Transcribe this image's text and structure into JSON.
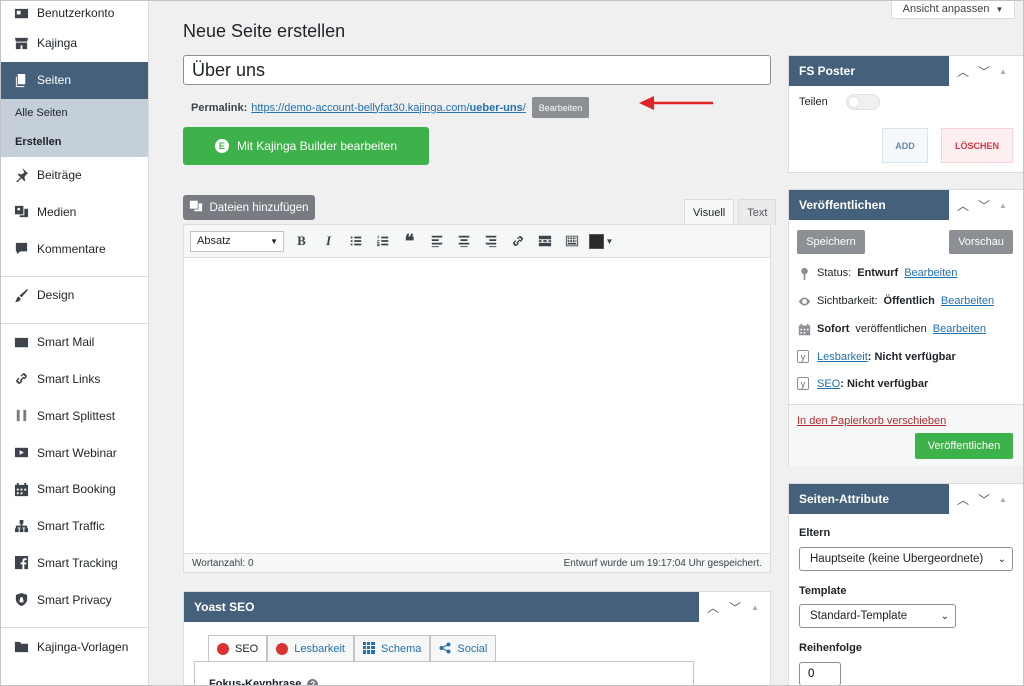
{
  "sidebar": {
    "items": [
      {
        "label": "Benutzerkonto",
        "icon": "id-card-icon"
      },
      {
        "label": "Kajinga",
        "icon": "store-icon"
      },
      {
        "label": "Seiten",
        "icon": "pages-icon",
        "current": true
      },
      {
        "label": "Beiträge",
        "icon": "pin-icon"
      },
      {
        "label": "Medien",
        "icon": "media-icon"
      },
      {
        "label": "Kommentare",
        "icon": "comment-icon"
      },
      {
        "label": "Design",
        "icon": "brush-icon"
      },
      {
        "label": "Smart Mail",
        "icon": "mail-icon"
      },
      {
        "label": "Smart Links",
        "icon": "link-icon"
      },
      {
        "label": "Smart Splittest",
        "icon": "splittest-icon"
      },
      {
        "label": "Smart Webinar",
        "icon": "video-icon"
      },
      {
        "label": "Smart Booking",
        "icon": "calendar-icon"
      },
      {
        "label": "Smart Traffic",
        "icon": "network-icon"
      },
      {
        "label": "Smart Tracking",
        "icon": "facebook-icon"
      },
      {
        "label": "Smart Privacy",
        "icon": "shield-icon"
      },
      {
        "label": "Kajinga-Vorlagen",
        "icon": "folder-icon"
      }
    ],
    "submenu": [
      "Alle Seiten",
      "Erstellen"
    ]
  },
  "screen_options": "Ansicht anpassen",
  "page_title": "Neue Seite erstellen",
  "post_title": "Über uns",
  "permalink": {
    "label": "Permalink:",
    "url_base": "https://demo-account-bellyfat30.kajinga.com/",
    "slug": "ueber-uns",
    "url_end": "/",
    "edit_button": "Bearbeiten"
  },
  "builder_button": "Mit Kajinga Builder bearbeiten",
  "media_button": "Dateien hinzufügen",
  "editor": {
    "tabs": [
      "Visuell",
      "Text"
    ],
    "format_select": "Absatz",
    "word_count": "Wortanzahl: 0",
    "draft_status": "Entwurf wurde um 19:17:04 Uhr gespeichert."
  },
  "yoast": {
    "title": "Yoast SEO",
    "tabs": [
      "SEO",
      "Lesbarkeit",
      "Schema",
      "Social"
    ],
    "field_label": "Fokus-Keyphrase"
  },
  "fs_poster": {
    "title": "FS Poster",
    "share_label": "Teilen",
    "add": "ADD",
    "delete": "LÖSCHEN"
  },
  "publish": {
    "title": "Veröffentlichen",
    "save": "Speichern",
    "preview": "Vorschau",
    "status_label": "Status:",
    "status_value": "Entwurf",
    "visibility_label": "Sichtbarkeit:",
    "visibility_value": "Öffentlich",
    "schedule_value": "Sofort",
    "schedule_label": "veröffentlichen",
    "edit": "Bearbeiten",
    "readability_link": "Lesbarkeit",
    "readability_value": ": Nicht verfügbar",
    "seo_link": "SEO",
    "seo_value": ": Nicht verfügbar",
    "trash": "In den Papierkorb verschieben",
    "publish_button": "Veröffentlichen"
  },
  "page_attributes": {
    "title": "Seiten-Attribute",
    "parent_label": "Eltern",
    "parent_value": "Hauptseite (keine Übergeordnete)",
    "template_label": "Template",
    "template_value": "Standard-Template",
    "order_label": "Reihenfolge",
    "order_value": "0"
  },
  "colors": {
    "accent": "#45607b",
    "green": "#3db24a",
    "arrow": "#e02424"
  }
}
